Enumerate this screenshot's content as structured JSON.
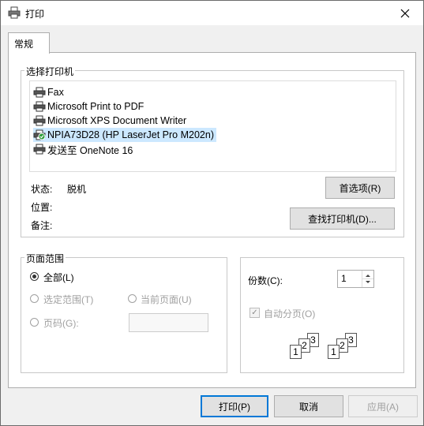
{
  "window": {
    "title": "打印"
  },
  "tabs": [
    {
      "label": "常规"
    }
  ],
  "printer_group": {
    "label": "选择打印机",
    "printers": [
      {
        "name": "Fax"
      },
      {
        "name": "Microsoft Print to PDF"
      },
      {
        "name": "Microsoft XPS Document Writer"
      },
      {
        "name": "NPIA73D28 (HP LaserJet Pro M202n)",
        "selected": true
      },
      {
        "name": "发送至 OneNote 16"
      }
    ],
    "status_label": "状态:",
    "status_value": "脱机",
    "location_label": "位置:",
    "comment_label": "备注:",
    "preferences_button": "首选项(R)",
    "find_printer_button": "查找打印机(D)..."
  },
  "page_range": {
    "label": "页面范围",
    "all": "全部(L)",
    "selection": "选定范围(T)",
    "current_page": "当前页面(U)",
    "pages": "页码(G):"
  },
  "copies": {
    "label": "份数(C):",
    "value": "1",
    "collate": "自动分页(O)",
    "collate_checked": true
  },
  "buttons": {
    "print": "打印(P)",
    "cancel": "取消",
    "apply": "应用(A)"
  },
  "colors": {
    "selection": "#cce8ff",
    "accent": "#0078d7"
  }
}
